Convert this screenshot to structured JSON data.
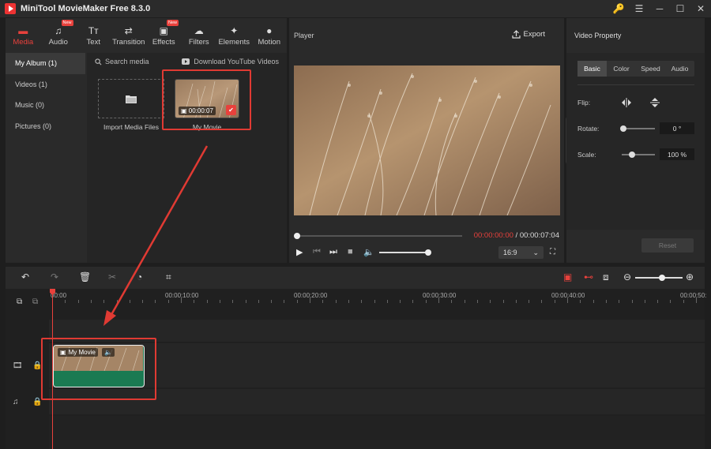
{
  "window": {
    "title": "MiniTool MovieMaker Free 8.3.0",
    "controls": [
      "🔑",
      "☰",
      "─",
      "☐",
      "✕"
    ]
  },
  "toolbar": {
    "items": [
      {
        "label": "Media",
        "icon": "▬",
        "active": true
      },
      {
        "label": "Audio",
        "icon": "♫",
        "badge": "New"
      },
      {
        "label": "Text",
        "icon": "Tт"
      },
      {
        "label": "Transition",
        "icon": "⇄"
      },
      {
        "label": "Effects",
        "icon": "▣",
        "badge": "New"
      },
      {
        "label": "Filters",
        "icon": "☁"
      },
      {
        "label": "Elements",
        "icon": "✦"
      },
      {
        "label": "Motion",
        "icon": "●"
      }
    ]
  },
  "album": {
    "items": [
      "My Album (1)",
      "Videos (1)",
      "Music (0)",
      "Pictures (0)"
    ]
  },
  "media": {
    "search_label": "Search media",
    "download_label": "Download YouTube Videos",
    "import_label": "Import Media Files",
    "movie_label": "My Movie",
    "movie_duration": "00:00:07"
  },
  "player": {
    "title": "Player",
    "export_label": "Export",
    "current_time": "00:00:00:00",
    "total_time": "00:00:07:04",
    "time_separator": " / ",
    "aspect": "16:9",
    "progress": 0,
    "volume": 1.0
  },
  "property": {
    "title": "Video Property",
    "tabs": [
      "Basic",
      "Color",
      "Speed",
      "Audio"
    ],
    "active_tab": "Basic",
    "flip_label": "Flip:",
    "rotate_label": "Rotate:",
    "rotate_value": "0 °",
    "scale_label": "Scale:",
    "scale_value": "100 %",
    "reset_label": "Reset"
  },
  "timeline": {
    "ruler": [
      "00:00",
      "00:00:10:00",
      "00:00:20:00",
      "00:00:30:00",
      "00:00:40:00",
      "00:00:50:"
    ],
    "clip_label": "My Movie"
  },
  "colors": {
    "accent": "#e8413c",
    "clip_green": "#1a7a52",
    "annotation": "#e03a33"
  }
}
